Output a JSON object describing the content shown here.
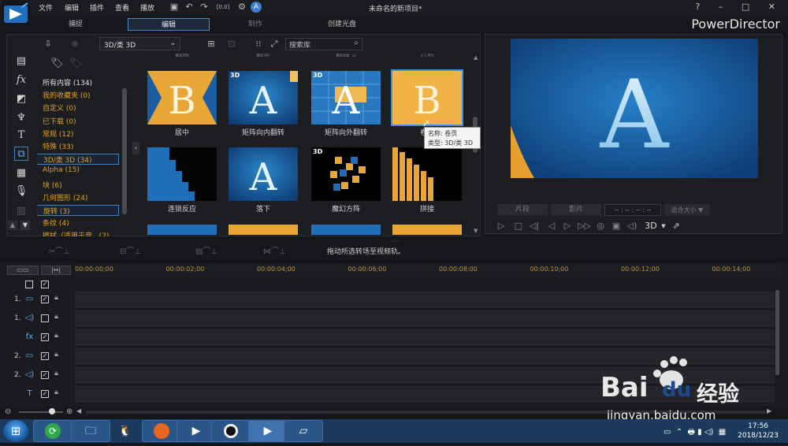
{
  "titlebar": {
    "menus": [
      "文件",
      "编辑",
      "插件",
      "查看",
      "播放"
    ],
    "title": "未命名的新项目*",
    "window_controls": "? – □ ✕",
    "zoom_badge": "[0.0]"
  },
  "modes": {
    "capture": "捕捉",
    "edit": "编辑",
    "produce": "制作",
    "disc": "创建光盘"
  },
  "brand": "PowerDirector",
  "library": {
    "dropdown": "3D/类 3D",
    "search_placeholder": "搜索库",
    "categories": [
      {
        "label": "所有内容 (134)",
        "color": "#e0e0e0"
      },
      {
        "label": "我的收藏夹  (0)"
      },
      {
        "label": "自定义  (0)"
      },
      {
        "label": "已下载  (0)"
      },
      {
        "label": "常规  (12)"
      },
      {
        "label": "特殊  (33)"
      },
      {
        "label": "3D/类 3D  (34)",
        "selected": true
      },
      {
        "label": "Alpha  (15)"
      },
      {
        "label": "块  (6)"
      },
      {
        "label": "几何图形  (24)"
      },
      {
        "label": "旋转  (3)",
        "selected": true
      },
      {
        "label": "条纹  (4)"
      },
      {
        "label": "擦拭（适用于音...(2)"
      }
    ],
    "top_labels": [
      "翻圆",
      "翻页",
      "翻转 II",
      "分裂"
    ],
    "row1": [
      "居中",
      "矩阵向内翻转",
      "矩阵向外翻转",
      "卷页"
    ],
    "row2": [
      "连锁反应",
      "落下",
      "魔幻方阵",
      "拼接"
    ]
  },
  "tooltip": {
    "name": "名称: 卷页",
    "type": "类型: 3D/类 3D"
  },
  "preview": {
    "btn_clip": "片段",
    "btn_film": "影片",
    "timecode": "-- : -- : -- : --",
    "fit": "适合大小 ▼",
    "stereo": "3D"
  },
  "status": "拖动所选转场至视频轨。",
  "ruler": [
    "00:00:00;00",
    "00:00:02;00",
    "00:00:04;00",
    "00:00:06;00",
    "00:00:08;00",
    "00:00:10;00",
    "00:00:12;00",
    "00:00:14;00"
  ],
  "tracks": [
    {
      "num": "1.",
      "icon": "video-icon",
      "glyph": "▭"
    },
    {
      "num": "1.",
      "icon": "audio-icon",
      "glyph": "◁)"
    },
    {
      "num": "",
      "icon": "fx-icon",
      "glyph": "fx"
    },
    {
      "num": "2.",
      "icon": "video-icon",
      "glyph": "▭"
    },
    {
      "num": "2.",
      "icon": "audio-icon",
      "glyph": "◁)"
    },
    {
      "num": "",
      "icon": "title-icon",
      "glyph": "T"
    }
  ],
  "clock": {
    "time": "17:56",
    "date": "2018/12/23"
  },
  "watermark": {
    "brand": "Bai",
    "brand2": "du",
    "cn": "经验",
    "url": "jingyan.baidu.com"
  },
  "colors": {
    "accent": "#3f8fe0",
    "category": "#e2a020",
    "taskbar": "#1c3a5e"
  }
}
